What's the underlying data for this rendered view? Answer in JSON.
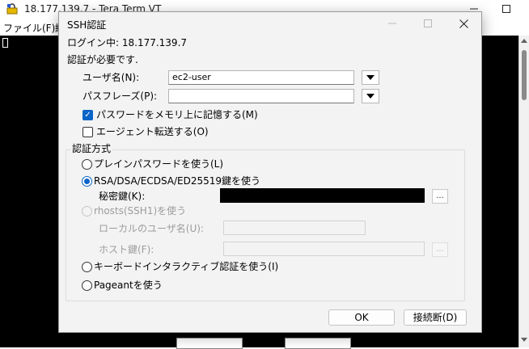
{
  "background_window": {
    "title": "18.177.139.7 - Tera Term VT",
    "menu_file": "ファイル(F)",
    "menu_partial": "編"
  },
  "dialog": {
    "title": "SSH認証",
    "login_status": "ログイン中: 18.177.139.7",
    "auth_required": "認証が必要です.",
    "username_label": "ユーザ名(N):",
    "username_value": "ec2-user",
    "passphrase_label": "パスフレーズ(P):",
    "passphrase_value": "",
    "remember_password_label": "パスワードをメモリ上に記憶する(M)",
    "remember_password_checked": true,
    "agent_forward_label": "エージェント転送する(O)",
    "agent_forward_checked": false,
    "auth_method_group": "認証方式",
    "methods": {
      "plain_password": "プレインパスワードを使う(L)",
      "rsa_key": "RSA/DSA/ECDSA/ED25519鍵を使う",
      "private_key_label": "秘密鍵(K):",
      "rhosts": "rhosts(SSH1)を使う",
      "local_username_label": "ローカルのユーザ名(U):",
      "host_key_label": "ホスト鍵(F):",
      "keyboard_interactive": "キーボードインタラクティブ認証を使う(I)",
      "pageant": "Pageantを使う"
    },
    "selected_method": "rsa_key",
    "browse_label": "...",
    "ok_label": "OK",
    "disconnect_label": "接続断(D)"
  },
  "icons": {
    "app": "tera-term-icon",
    "minimize": "minimize-icon",
    "maximize": "maximize-icon",
    "close": "close-icon",
    "dropdown": "chevron-down-icon",
    "checkmark": "checkmark-icon"
  },
  "colors": {
    "accent": "#0a64c8",
    "terminal_bg": "#000000",
    "dialog_bg": "#f3f3f3",
    "disabled_text": "#9c9c9c"
  }
}
